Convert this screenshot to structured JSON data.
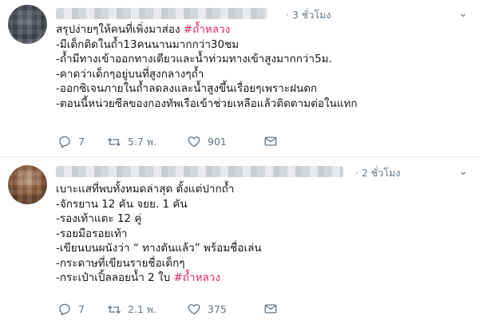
{
  "tweets": [
    {
      "time": "3 ชั่วโมง",
      "lines": [
        {
          "text": "สรุปง่ายๆให้คนที่เพิ่งมาส่อง ",
          "hashtag": "#ถ้ำหลวง"
        },
        {
          "text": "-มีเด็กติดในถ้ำ13คนนานมากกว่า30ชม",
          "hashtag": ""
        },
        {
          "text": "-ถ้ำมีทางเข้าออกทางเดียวและน้ำท่วมทางเข้าสูงมากกว่า5ม.",
          "hashtag": ""
        },
        {
          "text": "-คาดว่าเด็กๆอยู่บนที่สูงกลางๆถ้ำ",
          "hashtag": ""
        },
        {
          "text": "-ออกซิเจนภายในถ้ำลดลงและน้ำสูงขึ้นเรื่อยๆเพราะฝนตก",
          "hashtag": ""
        },
        {
          "text": "-ตอนนี้หน่วยซีลของกองทัพเรือเข้าช่วยเหลือแล้วติดตามต่อในแทก",
          "hashtag": ""
        }
      ],
      "replies": "7",
      "retweets": "5.7 พ.",
      "likes": "901"
    },
    {
      "time": "2 ชั่วโมง",
      "lines": [
        {
          "text": "เบาะแสที่พบทั้งหมดล่าสุด ตั้งแต่ปากถ้ำ",
          "hashtag": ""
        },
        {
          "text": "-จักรยาน 12 คัน จยย. 1 คัน",
          "hashtag": ""
        },
        {
          "text": "-รองเท้าแตะ 12 คู่",
          "hashtag": ""
        },
        {
          "text": "-รอยมือรอยเท้า",
          "hashtag": ""
        },
        {
          "text": "-เขียนบนผนังว่า “ ทางตันแล้ว” พร้อมชื่อเล่น",
          "hashtag": ""
        },
        {
          "text": "-กระดาษที่เขียนรายชื่อเด็กๆ",
          "hashtag": ""
        },
        {
          "text": "-กระเป๋าเปิ้ลลอยน้ำ 2 ใบ  ",
          "hashtag": "#ถ้ำหลวง"
        }
      ],
      "replies": "7",
      "retweets": "2.1 พ.",
      "likes": "375"
    }
  ],
  "colors": {
    "hashtag": "#e0245e",
    "secondary_text": "#657786",
    "divider": "#e6ecf0"
  },
  "icons": [
    "reply-icon",
    "retweet-icon",
    "like-icon",
    "direct-message-icon",
    "caret-down-icon"
  ]
}
